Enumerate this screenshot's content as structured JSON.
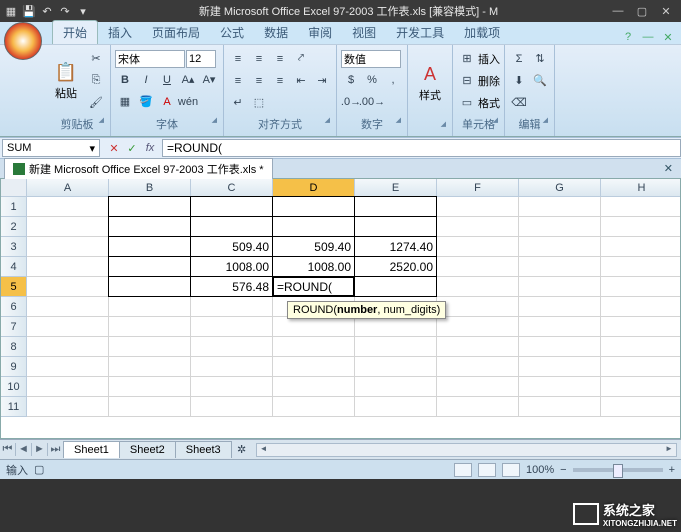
{
  "window": {
    "title": "新建 Microsoft Office Excel 97-2003 工作表.xls  [兼容模式] - M"
  },
  "ribbon": {
    "tabs": [
      "开始",
      "插入",
      "页面布局",
      "公式",
      "数据",
      "审阅",
      "视图",
      "开发工具",
      "加载项"
    ],
    "clipboard": {
      "paste": "粘贴",
      "label": "剪贴板"
    },
    "font": {
      "name": "宋体",
      "size": "12",
      "label": "字体",
      "bold": "B",
      "italic": "I",
      "underline": "U"
    },
    "align": {
      "label": "对齐方式"
    },
    "number": {
      "format": "数值",
      "label": "数字"
    },
    "styles": {
      "btn": "样式",
      "label": ""
    },
    "cells": {
      "insert": "插入",
      "delete": "删除",
      "format": "格式",
      "label": "单元格"
    },
    "editing": {
      "label": "编辑"
    }
  },
  "formula_bar": {
    "name_box": "SUM",
    "formula": "=ROUND(",
    "fx": "fx"
  },
  "workbook_tab": {
    "name": "新建 Microsoft Office Excel 97-2003 工作表.xls *"
  },
  "grid": {
    "columns": [
      "A",
      "B",
      "C",
      "D",
      "E",
      "F",
      "G",
      "H"
    ],
    "row_count": 11,
    "active_row": 5,
    "active_col": "D",
    "data": {
      "3": {
        "C": "509.40",
        "D": "509.40",
        "E": "1274.40"
      },
      "4": {
        "C": "1008.00",
        "D": "1008.00",
        "E": "2520.00"
      },
      "5": {
        "C": "576.48",
        "D": "=ROUND("
      }
    },
    "tooltip": {
      "fn": "ROUND(",
      "arg1": "number",
      "rest": ", num_digits)"
    }
  },
  "sheets": {
    "tabs": [
      "Sheet1",
      "Sheet2",
      "Sheet3"
    ]
  },
  "status": {
    "mode": "输入",
    "zoom": "100%",
    "minus": "−",
    "plus": "+"
  },
  "watermark": {
    "text": "系统之家",
    "url": "XITONGZHIJIA.NET"
  }
}
